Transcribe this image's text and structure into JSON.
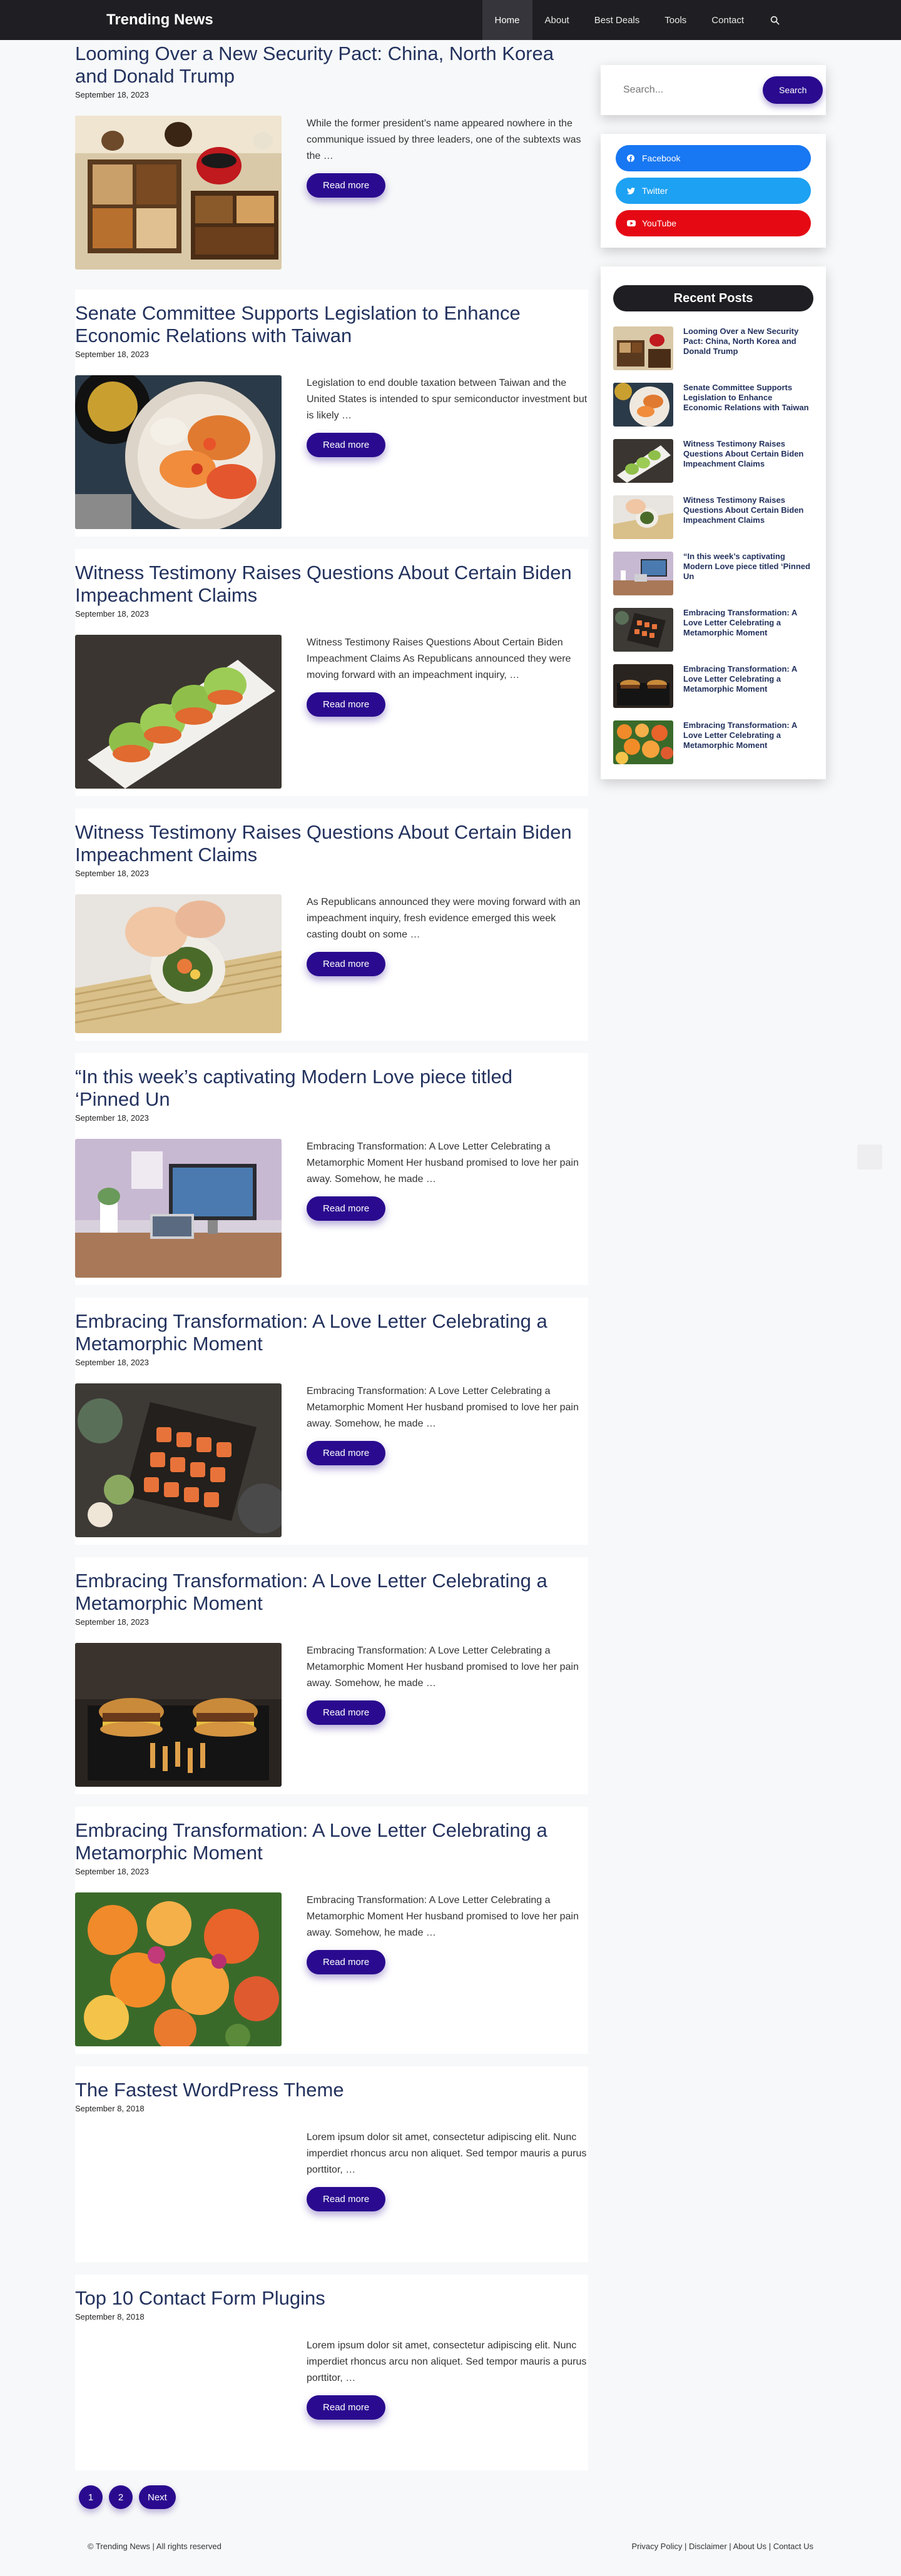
{
  "header": {
    "site_title": "Trending News",
    "nav": [
      {
        "label": "Home",
        "active": true
      },
      {
        "label": "About",
        "active": false
      },
      {
        "label": "Best Deals",
        "active": false
      },
      {
        "label": "Tools",
        "active": false
      },
      {
        "label": "Contact",
        "active": false
      }
    ],
    "search_icon": "search-icon"
  },
  "read_more_label": "Read more",
  "posts": [
    {
      "title": "Looming Over a New Security Pact: China, North Korea and Donald Trump",
      "date": "September 18, 2023",
      "excerpt": "While the former president’s name appeared nowhere in the communique issued by three leaders, one of the subtexts was the …",
      "image": "bento-box-photo"
    },
    {
      "title": "Senate Committee Supports Legislation to Enhance Economic Relations with Taiwan",
      "date": "September 18, 2023",
      "excerpt": "Legislation to end double taxation between Taiwan and the United States is intended to spur semiconductor investment but is likely …",
      "image": "sushi-platter-photo"
    },
    {
      "title": "Witness Testimony Raises Questions About Certain Biden Impeachment Claims",
      "date": "September 18, 2023",
      "excerpt": "Witness Testimony Raises Questions About Certain Biden Impeachment Claims As Republicans announced they were moving forward with an impeachment inquiry, …",
      "image": "sushi-roll-photo"
    },
    {
      "title": "Witness Testimony Raises Questions About Certain Biden Impeachment Claims",
      "date": "September 18, 2023",
      "excerpt": "As Republicans announced they were moving forward with an impeachment inquiry, fresh evidence emerged this week casting doubt on some …",
      "image": "rolling-sushi-photo"
    },
    {
      "title": "“In this week’s captivating Modern Love piece titled ‘Pinned Un",
      "date": "September 18, 2023",
      "excerpt": "Embracing Transformation: A Love Letter Celebrating a Metamorphic Moment Her husband promised to love her pain away. Somehow, he made …",
      "image": "desk-workspace-photo"
    },
    {
      "title": "Embracing Transformation: A Love Letter Celebrating a Metamorphic Moment",
      "date": "September 18, 2023",
      "excerpt": "Embracing Transformation: A Love Letter Celebrating a Metamorphic Moment Her husband promised to love her pain away. Somehow, he made …",
      "image": "sushi-board-photo"
    },
    {
      "title": "Embracing Transformation: A Love Letter Celebrating a Metamorphic Moment",
      "date": "September 18, 2023",
      "excerpt": "Embracing Transformation: A Love Letter Celebrating a Metamorphic Moment Her husband promised to love her pain away. Somehow, he made …",
      "image": "burgers-tray-photo"
    },
    {
      "title": "Embracing Transformation: A Love Letter Celebrating a Metamorphic Moment",
      "date": "September 18, 2023",
      "excerpt": "Embracing Transformation: A Love Letter Celebrating a Metamorphic Moment Her husband promised to love her pain away. Somehow, he made …",
      "image": "flower-bouquet-photo"
    },
    {
      "title": "The Fastest WordPress Theme",
      "date": "September 8, 2018",
      "excerpt": "Lorem ipsum dolor sit amet, consectetur adipiscing elit. Nunc imperdiet rhoncus arcu non aliquet. Sed tempor mauris a purus porttitor, …",
      "image": "none"
    },
    {
      "title": "Top 10 Contact Form Plugins",
      "date": "September 8, 2018",
      "excerpt": "Lorem ipsum dolor sit amet, consectetur adipiscing elit. Nunc imperdiet rhoncus arcu non aliquet. Sed tempor mauris a purus porttitor, …",
      "image": "none"
    }
  ],
  "pagination": {
    "pages": [
      "1",
      "2"
    ],
    "next_label": "Next"
  },
  "sidebar": {
    "search": {
      "placeholder": "Search...",
      "button_label": "Search"
    },
    "social": [
      {
        "label": "Facebook",
        "color": "#1877f2",
        "icon": "facebook-icon"
      },
      {
        "label": "Twitter",
        "color": "#1da1f2",
        "icon": "twitter-icon"
      },
      {
        "label": "YouTube",
        "color": "#e50914",
        "icon": "youtube-icon"
      }
    ],
    "recent_heading": "Recent Posts",
    "recent_posts": [
      "Looming Over a New Security Pact: China, North Korea and Donald Trump",
      "Senate Committee Supports Legislation to Enhance Economic Relations with Taiwan",
      "Witness Testimony Raises Questions About Certain Biden Impeachment Claims",
      "Witness Testimony Raises Questions About Certain Biden Impeachment Claims",
      "“In this week’s captivating Modern Love piece titled ‘Pinned Un",
      "Embracing Transformation: A Love Letter Celebrating a Metamorphic Moment",
      "Embracing Transformation: A Love Letter Celebrating a Metamorphic Moment",
      "Embracing Transformation: A Love Letter Celebrating a Metamorphic Moment"
    ]
  },
  "footer": {
    "copyright": "© Trending News | All rights reserved",
    "links": [
      "Privacy Policy",
      "Disclaimer",
      "About Us",
      "Contact Us"
    ]
  },
  "colors": {
    "accent": "#2a0b8f",
    "header_bg": "#1f1f23",
    "title": "#23325e"
  }
}
